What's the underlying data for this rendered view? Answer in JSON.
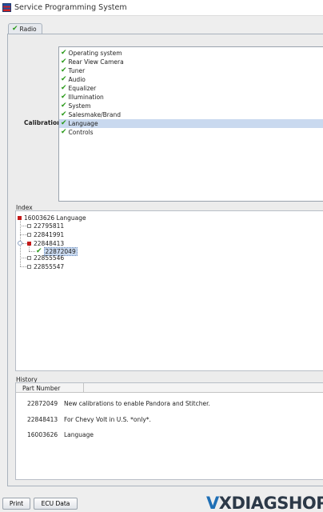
{
  "window": {
    "title": "Service Programming System"
  },
  "tab": {
    "label": "Radio"
  },
  "calibration": {
    "label": "Calibration",
    "items": [
      {
        "label": "Operating system"
      },
      {
        "label": "Rear View Camera"
      },
      {
        "label": "Tuner"
      },
      {
        "label": "Audio"
      },
      {
        "label": "Equalizer"
      },
      {
        "label": "Illumination"
      },
      {
        "label": "System"
      },
      {
        "label": "Salesmake/Brand"
      },
      {
        "label": "Language",
        "selected": true
      },
      {
        "label": "Controls"
      }
    ]
  },
  "index": {
    "title": "Index",
    "root": "16003626 Language",
    "children": [
      "22795811",
      "22841991",
      "22848413",
      "22855546",
      "22855547"
    ],
    "expanded_child": "22872049"
  },
  "history": {
    "title": "History",
    "column": "Part Number",
    "rows": [
      {
        "part": "22872049",
        "desc": "New calibrations to enable Pandora and Stitcher."
      },
      {
        "part": "22848413",
        "desc": "For Chevy Volt in U.S. *only*."
      },
      {
        "part": "16003626",
        "desc": "Language"
      }
    ]
  },
  "buttons": {
    "print": "Print",
    "ecu_data": "ECU Data"
  },
  "watermark": {
    "prefix": "V",
    "text": "XDIAGSHOP"
  },
  "colors": {
    "check": "#2a9a1a",
    "selection": "#c9d9ef",
    "red_marker": "#c41a1a"
  }
}
